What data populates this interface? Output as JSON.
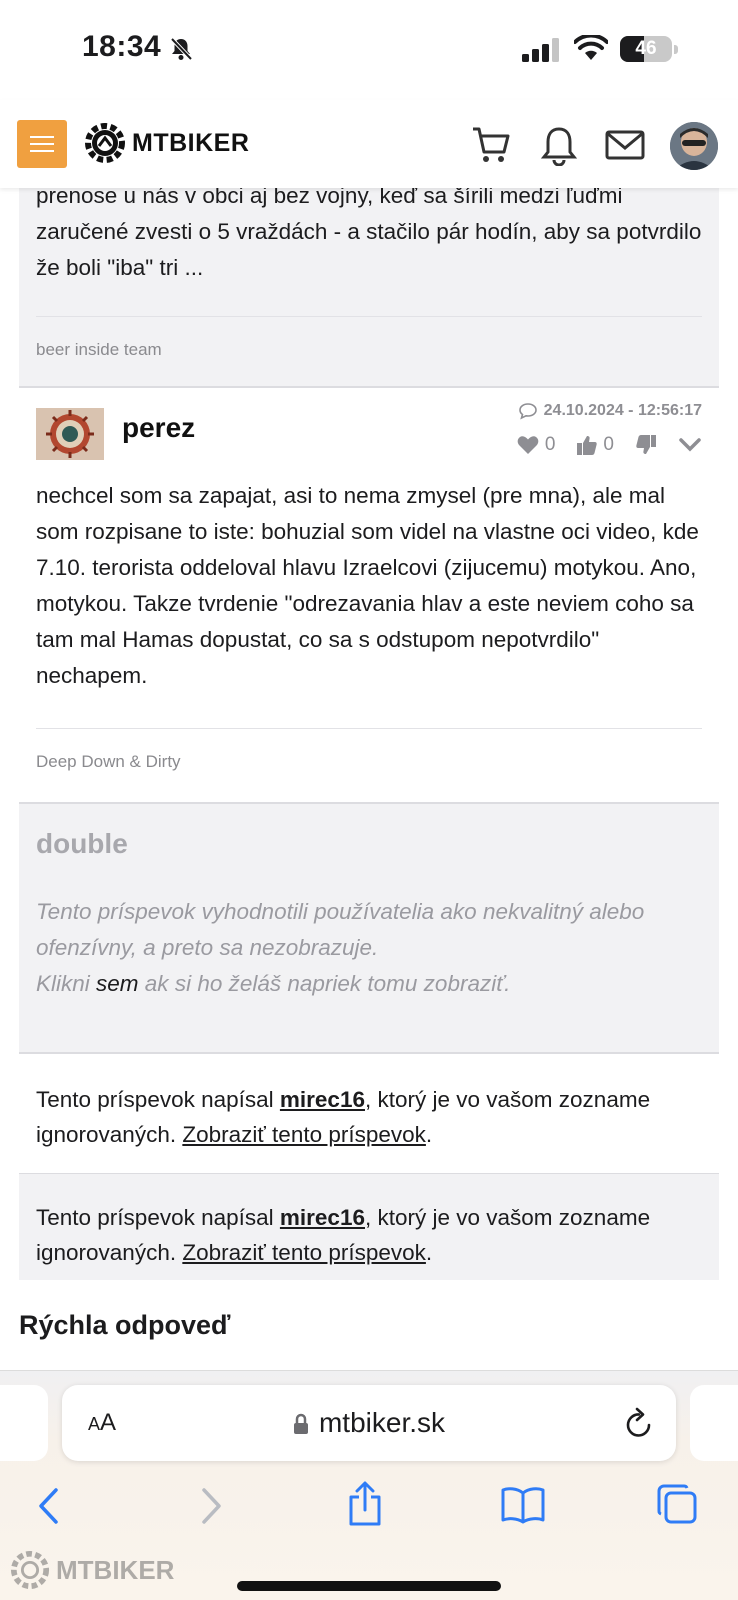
{
  "status_bar": {
    "time": "18:34",
    "battery": "46",
    "battery_level": 0.46
  },
  "header": {
    "brand": "MTBIKER",
    "icons": [
      "menu-icon",
      "cart-icon",
      "bell-icon",
      "mail-icon",
      "avatar"
    ]
  },
  "posts": [
    {
      "text": "prenose u nás v obci aj bez vojny, keď sa šírili medzi ľuďmi zaručené zvesti o 5 vraždách - a stačilo pár hodín, aby sa potvrdilo že boli \"iba\" tri ...",
      "signature": "beer inside team"
    },
    {
      "author": "perez",
      "date": "24.10.2024 - 12:56:17",
      "likes": "0",
      "thumbs_up": "0",
      "text": "nechcel som sa zapajat, asi to nema zmysel (pre mna), ale mal som rozpisane to iste: bohuzial som videl na vlastne oci video, kde 7.10. terorista oddeloval hlavu Izraelcovi (zijucemu) motykou. Ano, motykou. Takze tvrdenie \"odrezavania hlav a este neviem coho sa tam mal Hamas dopustat, co sa s odstupom nepotvrdilo\" nechapem.",
      "signature": "Deep Down & Dirty"
    },
    {
      "author": "double",
      "hidden_line1": "Tento príspevok vyhodnotili používatelia ako nekvalitný alebo ofenzívny, a preto sa nezobrazuje.",
      "hidden_prefix": "Klikni ",
      "hidden_link": "sem",
      "hidden_suffix": " ak si ho želáš napriek tomu zobraziť."
    }
  ],
  "ignored": [
    {
      "prefix": "Tento príspevok napísal ",
      "user": "mirec16",
      "middle": ", ktorý je vo vašom zozname ignorovaných. ",
      "link": "Zobraziť tento príspevok",
      "suffix": "."
    },
    {
      "prefix": "Tento príspevok napísal ",
      "user": "mirec16",
      "middle": ", ktorý je vo vašom zozname ignorovaných. ",
      "link": "Zobraziť tento príspevok",
      "suffix": "."
    }
  ],
  "quick_reply": "Rýchla odpoveď",
  "browser": {
    "aa_small": "A",
    "aa_large": "A",
    "url": "mtbiker.sk"
  },
  "watermark": "MTBIKER"
}
